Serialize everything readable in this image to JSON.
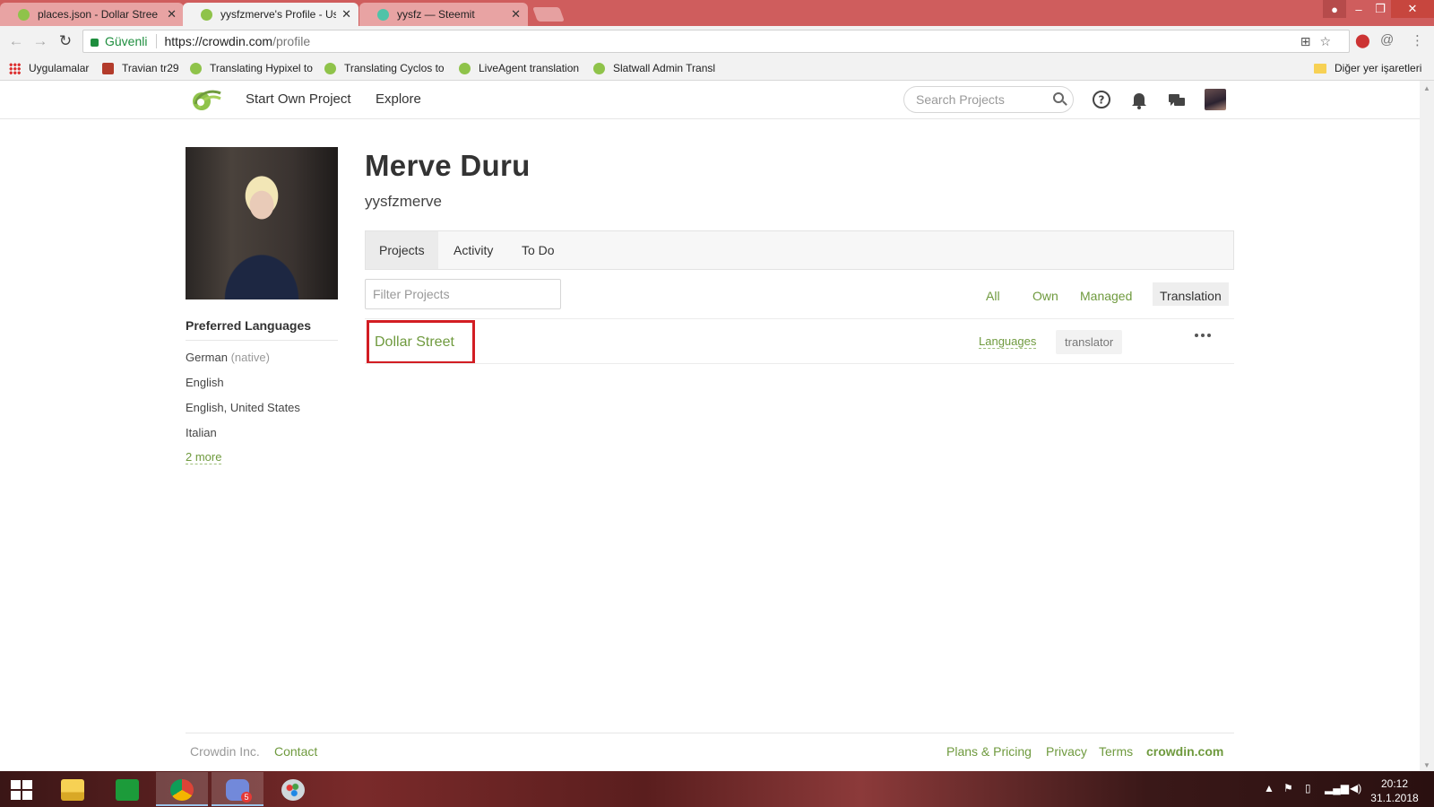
{
  "browser": {
    "tabs": [
      {
        "title": "places.json - Dollar Stree",
        "active": false
      },
      {
        "title": "yysfzmerve's Profile - Us",
        "active": true
      },
      {
        "title": "yysfz — Steemit",
        "active": false
      }
    ],
    "close_glyph": "✕",
    "secure_label": "Güvenli",
    "url_host": "https://crowdin.com",
    "url_path": "/profile",
    "bookmarks": [
      {
        "label": "Uygulamalar",
        "icon": "apps-grid-icon"
      },
      {
        "label": "Travian tr29",
        "icon": "travian-icon"
      },
      {
        "label": "Translating Hypixel to",
        "icon": "crowdin-icon"
      },
      {
        "label": "Translating Cyclos to",
        "icon": "crowdin-icon"
      },
      {
        "label": "LiveAgent translation",
        "icon": "crowdin-icon"
      },
      {
        "label": "Slatwall Admin Transl",
        "icon": "crowdin-icon"
      }
    ],
    "other_bookmarks": "Diğer yer işaretleri"
  },
  "header": {
    "nav": [
      "Start Own Project",
      "Explore"
    ],
    "search_placeholder": "Search Projects"
  },
  "profile": {
    "name": "Merve Duru",
    "username": "yysfzmerve",
    "preferred_languages_title": "Preferred Languages",
    "languages": [
      {
        "name": "German",
        "note": "(native)"
      },
      {
        "name": "English",
        "note": ""
      },
      {
        "name": "English, United States",
        "note": ""
      },
      {
        "name": "Italian",
        "note": ""
      }
    ],
    "more_link": "2 more",
    "tabs": [
      "Projects",
      "Activity",
      "To Do"
    ],
    "active_tab": "Projects",
    "filter_placeholder": "Filter Projects",
    "filters": [
      "All",
      "Own",
      "Managed",
      "Translation"
    ],
    "active_filter": "Translation",
    "projects": [
      {
        "name": "Dollar Street",
        "languages_link": "Languages",
        "role": "translator"
      }
    ]
  },
  "footer": {
    "company": "Crowdin Inc.",
    "contact": "Contact",
    "links": [
      "Plans & Pricing",
      "Privacy",
      "Terms"
    ],
    "brand": "crowdin.com"
  },
  "taskbar": {
    "time": "20:12",
    "date": "31.1.2018",
    "discord_badge": "5"
  },
  "colors": {
    "accent_green": "#6f9a3e",
    "highlight_red": "#d21d23",
    "tabstrip": "#cf5d5d"
  }
}
